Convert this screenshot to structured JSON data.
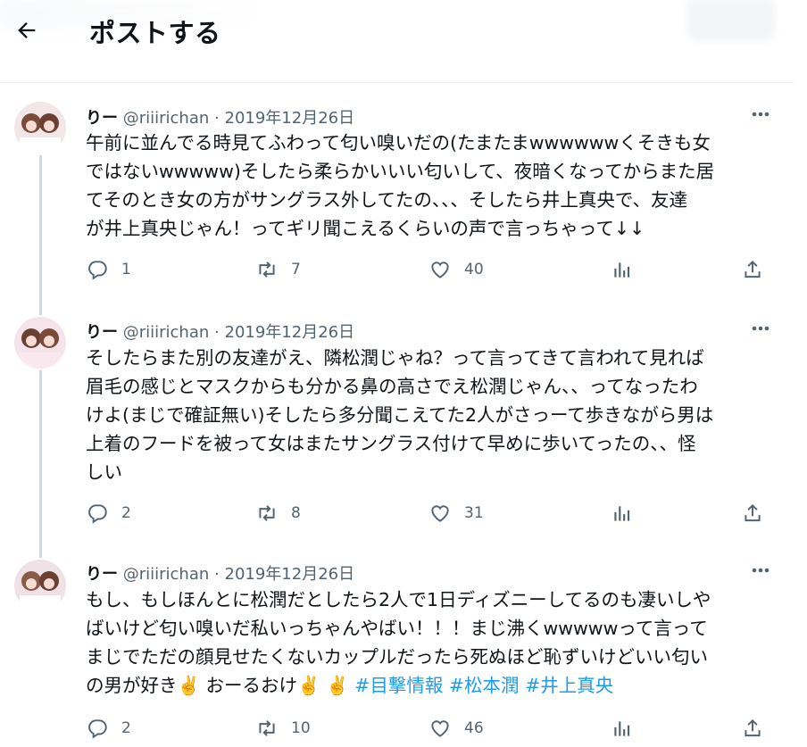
{
  "header": {
    "title": "ポストする"
  },
  "tweets": [
    {
      "name": "りー",
      "handle": "@riiirichan",
      "sep": "·",
      "date": "2019年12月26日",
      "lines": [
        "午前に並んでる時見てふわって匂い嗅いだの(たまたまwwwwwwくそきも女",
        "ではないwwwww)そしたら柔らかいいい匂いして、夜暗くなってからまた居",
        "てそのとき女の方がサングラス外してたの、、、そしたら井上真央で、友達",
        "が井上真央じゃん！ってギリ聞こえるくらいの声で言っちゃって↓↓"
      ],
      "replies": "1",
      "retweets": "7",
      "likes": "40"
    },
    {
      "name": "りー",
      "handle": "@riiirichan",
      "sep": "·",
      "date": "2019年12月26日",
      "lines": [
        "そしたらまた別の友達がえ、隣松潤じゃね？って言ってきて言われて見れば",
        "眉毛の感じとマスクからも分かる鼻の高さでえ松潤じゃん、、ってなったわ",
        "けよ(まじで確証無い)そしたら多分聞こえてた2人がさっーて歩きながら男は",
        "上着のフードを被って女はまたサングラス付けて早めに歩いてったの、、怪",
        "しい"
      ],
      "replies": "2",
      "retweets": "8",
      "likes": "31"
    },
    {
      "name": "りー",
      "handle": "@riiirichan",
      "sep": "·",
      "date": "2019年12月26日",
      "lines": [
        "もし、もしほんとに松潤だとしたら2人で1日ディズニーしてるのも凄いしや",
        "ばいけど匂い嗅いだ私いっちゃんやばい！！！まじ沸くwwwwwって言って",
        "まじでただの顔見せたくないカップルだったら死ぬほど恥ずいけどいい匂い"
      ],
      "last_line": "の男が好き✌️ おーるおけ✌️ ✌️",
      "hashtags": [
        "#目撃情報",
        "#松本潤",
        "#井上真央"
      ],
      "replies": "2",
      "retweets": "10",
      "likes": "46"
    }
  ]
}
